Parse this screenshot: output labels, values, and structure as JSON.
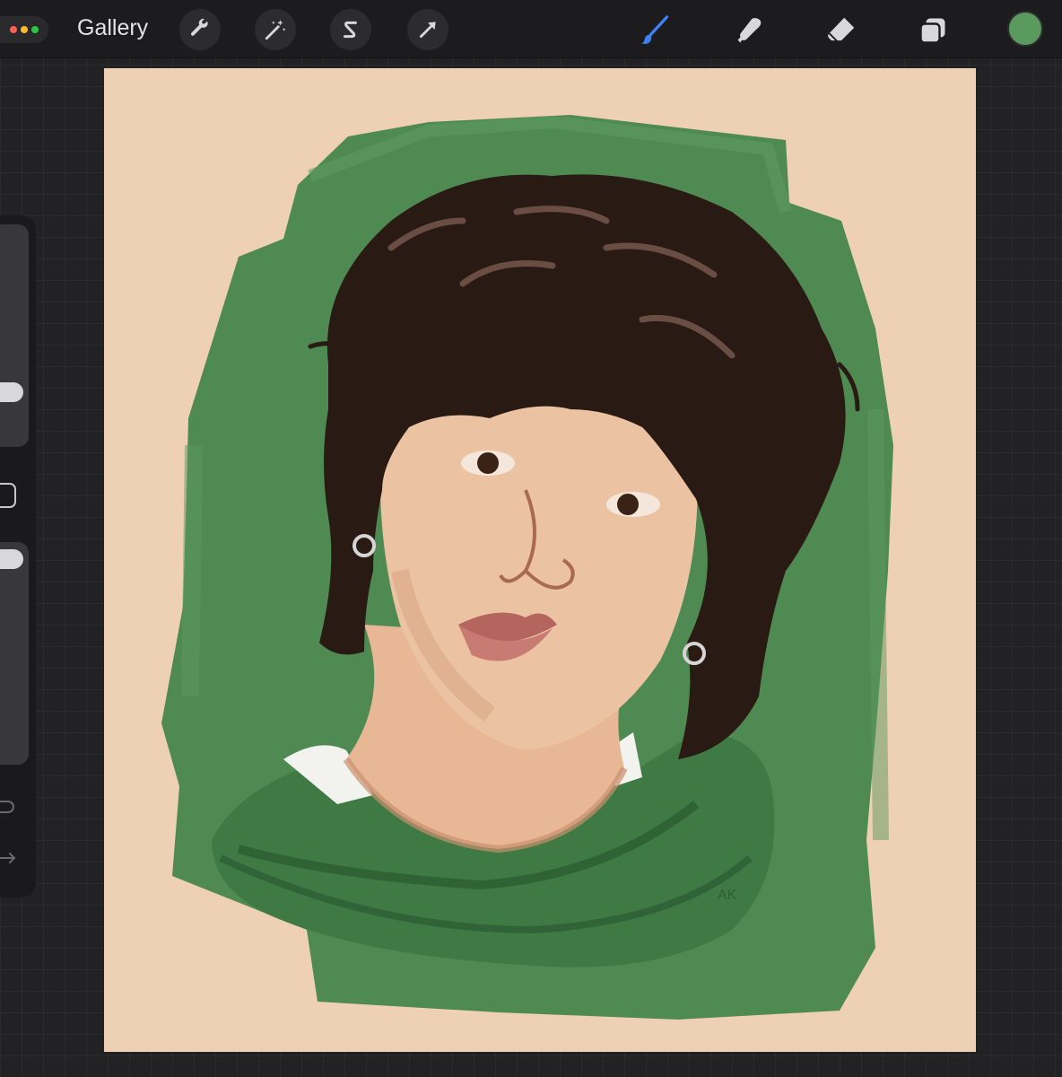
{
  "window": {
    "dot_colors": [
      "#ff5f57",
      "#febc2e",
      "#28c840"
    ]
  },
  "toolbar": {
    "gallery_label": "Gallery",
    "left_tools": [
      {
        "name": "actions",
        "icon": "wrench-icon"
      },
      {
        "name": "adjustments",
        "icon": "magic-wand-icon"
      },
      {
        "name": "selection",
        "icon": "selection-s-icon"
      },
      {
        "name": "transform",
        "icon": "arrow-cursor-icon"
      }
    ],
    "right_tools": [
      {
        "name": "brush",
        "icon": "brush-icon",
        "active": true
      },
      {
        "name": "smudge",
        "icon": "smudge-finger-icon",
        "active": false
      },
      {
        "name": "eraser",
        "icon": "eraser-icon",
        "active": false
      },
      {
        "name": "layers",
        "icon": "layers-icon",
        "active": false
      }
    ],
    "current_color": "#5a9a5e",
    "active_tool_color": "#3b82f6"
  },
  "sidebar": {
    "brush_size_level": 0.24,
    "opacity_level": 0.05
  },
  "canvas": {
    "background_color": "#eed0b4",
    "paint_green": "#4f8a52",
    "signature": "AK"
  }
}
